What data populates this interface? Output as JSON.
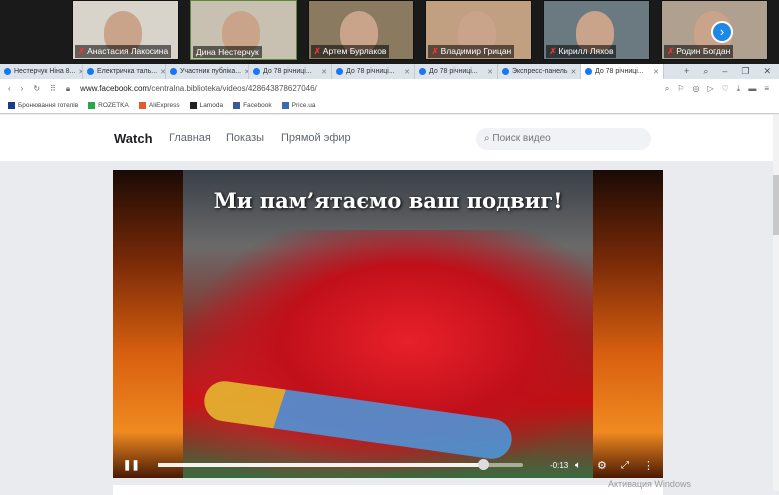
{
  "meeting": {
    "participants": [
      {
        "name": "Анастасия Лакосина",
        "muted": true,
        "active": false
      },
      {
        "name": "Дина Нестерчук",
        "muted": false,
        "active": true
      },
      {
        "name": "Артем Бурлаков",
        "muted": true,
        "active": false
      },
      {
        "name": "Владимир Грицан",
        "muted": true,
        "active": false
      },
      {
        "name": "Кирилл Ляхов",
        "muted": true,
        "active": false
      },
      {
        "name": "Родин Богдан",
        "muted": true,
        "active": false
      }
    ],
    "next_icon": "›"
  },
  "browser": {
    "tabs": [
      {
        "label": "Нестерчук Ніна 8..."
      },
      {
        "label": "Електричка таль..."
      },
      {
        "label": "Участник публіка..."
      },
      {
        "label": "До 78 річниці..."
      },
      {
        "label": "До 78 річниці..."
      },
      {
        "label": "До 78 річниці..."
      },
      {
        "label": "Экспресс-панель"
      },
      {
        "label": "До 78 річниці..."
      }
    ],
    "new_tab": "+",
    "url_host": "www.facebook.com",
    "url_path": "/centralna.biblioteka/videos/428643878627046/",
    "bookmarks": [
      {
        "label": "Бронювання готелів",
        "color": "#1a3a8a"
      },
      {
        "label": "ROZETKA",
        "color": "#2aa54a"
      },
      {
        "label": "AliExpress",
        "color": "#e45a2a"
      },
      {
        "label": "Lamoda",
        "color": "#222222"
      },
      {
        "label": "Facebook",
        "color": "#3b5998"
      },
      {
        "label": "Price.ua",
        "color": "#3a6ab0"
      }
    ]
  },
  "facebook": {
    "watch": "Watch",
    "nav": [
      "Главная",
      "Показы",
      "Прямой эфир"
    ],
    "search_placeholder": "Поиск видео"
  },
  "video": {
    "title": "Ми пам’ятаємо ваш подвиг!",
    "time_remaining": "-0:13",
    "progress": 0.89
  },
  "watermark": "Активация Windows"
}
